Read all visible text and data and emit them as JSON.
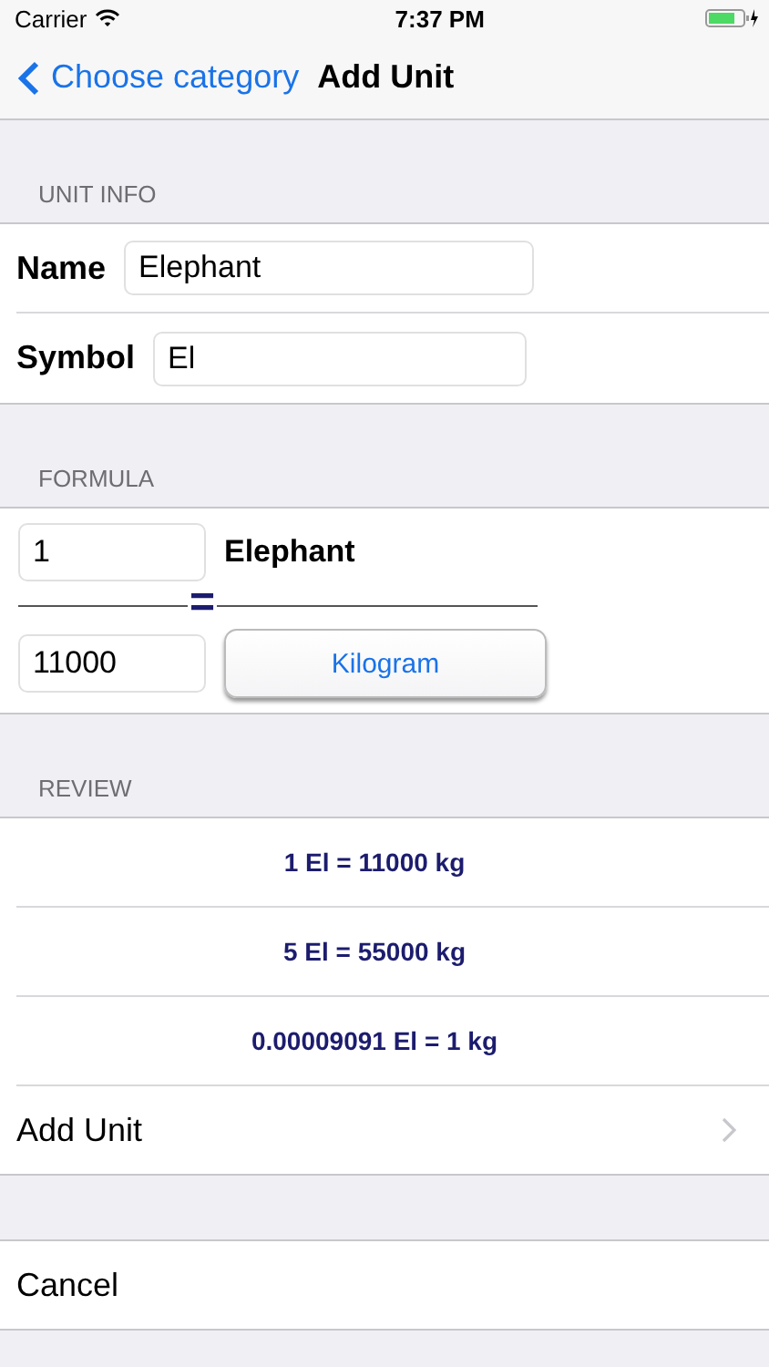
{
  "status_bar": {
    "carrier": "Carrier",
    "time": "7:37 PM"
  },
  "nav": {
    "back": "Choose category",
    "title": "Add Unit"
  },
  "unit_info": {
    "header": "UNIT INFO",
    "fields": [
      {
        "label": "Name",
        "value": "Elephant"
      },
      {
        "label": "Symbol",
        "value": "El"
      }
    ]
  },
  "formula": {
    "header": "FORMULA",
    "amount": "1",
    "unit_name": "Elephant",
    "equals": "=",
    "value": "11000",
    "target_unit": "Kilogram"
  },
  "review": {
    "header": "REVIEW",
    "rows": [
      "1 El = 11000 kg",
      "5 El = 55000 kg",
      "0.00009091 El = 1 kg"
    ]
  },
  "add_unit": "Add Unit",
  "cancel": "Cancel"
}
